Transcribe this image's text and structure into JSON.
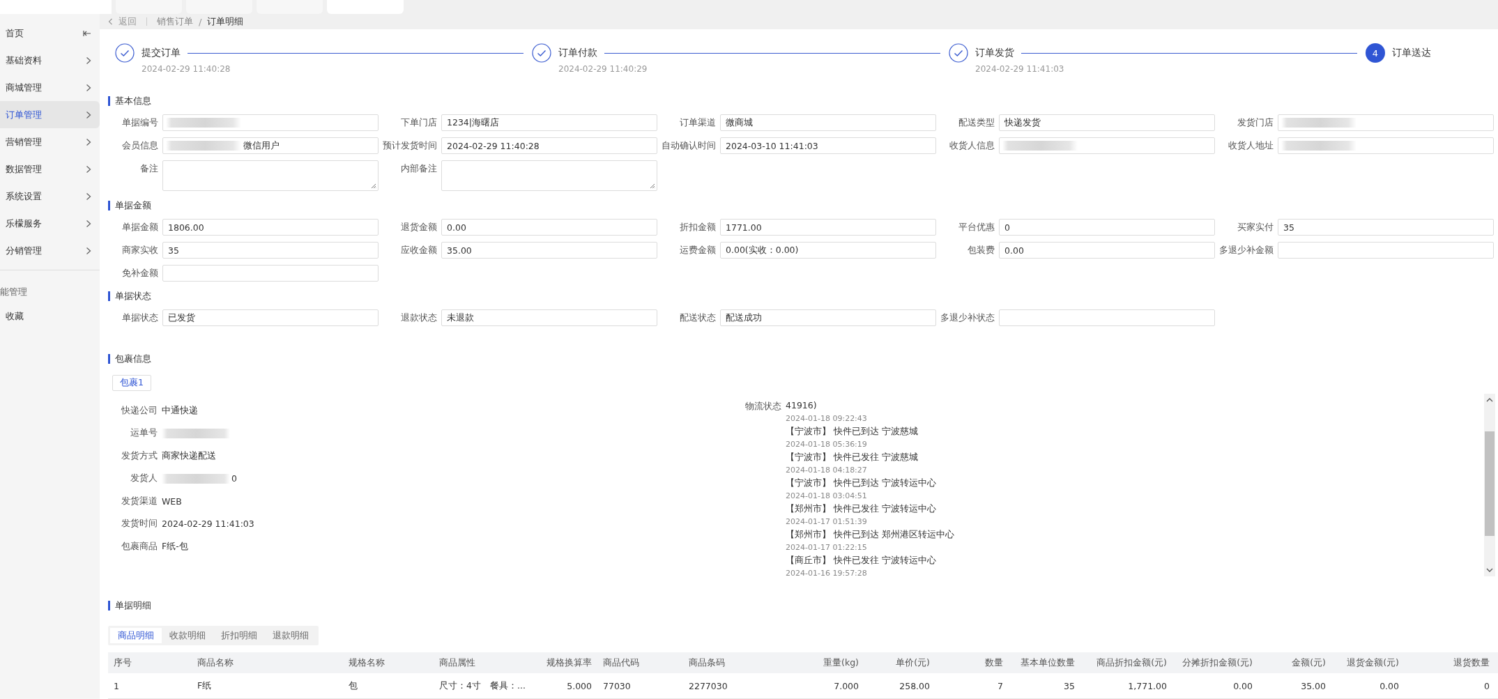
{
  "sidebar": {
    "items": [
      {
        "label": "首页",
        "kind": "collapse",
        "selected": false
      },
      {
        "label": "基础资料",
        "kind": "group",
        "selected": false
      },
      {
        "label": "商城管理",
        "kind": "group",
        "selected": false
      },
      {
        "label": "订单管理",
        "kind": "group",
        "selected": true
      },
      {
        "label": "营销管理",
        "kind": "group",
        "selected": false
      },
      {
        "label": "数据管理",
        "kind": "group",
        "selected": false
      },
      {
        "label": "系统设置",
        "kind": "group",
        "selected": false
      },
      {
        "label": "乐檬服务",
        "kind": "group",
        "selected": false
      },
      {
        "label": "分销管理",
        "kind": "group",
        "selected": false
      }
    ],
    "extra": [
      {
        "label": "能管理",
        "kind": "heading"
      },
      {
        "label": "收藏",
        "kind": "link"
      }
    ]
  },
  "breadcrumb": {
    "back": "返回",
    "items": [
      {
        "label": "销售订单",
        "current": false
      },
      {
        "label": "订单明细",
        "current": true
      }
    ],
    "separator": "/"
  },
  "steps": [
    {
      "label": "提交订单",
      "time": "2024-02-29 11:40:28",
      "completed": true
    },
    {
      "label": "订单付款",
      "time": "2024-02-29 11:40:29",
      "completed": true
    },
    {
      "label": "订单发货",
      "time": "2024-02-29 11:41:03",
      "completed": true
    },
    {
      "label": "订单送达",
      "number": "4",
      "completed": false
    }
  ],
  "sections": [
    {
      "title": "基本信息",
      "rows": [
        [
          {
            "label": "单据编号",
            "kind": "input",
            "redacted": true
          },
          {
            "label": "下单门店",
            "kind": "input",
            "value": "1234|海曙店",
            "redacted": false
          },
          {
            "label": "订单渠道",
            "kind": "input",
            "value": "微商城",
            "redacted": false
          },
          {
            "label": "配送类型",
            "kind": "input",
            "value": "快递发货",
            "redacted": false
          },
          {
            "label": "发货门店",
            "kind": "input",
            "redacted": true
          }
        ],
        [
          {
            "label": "会员信息",
            "kind": "input",
            "value": "微信用户",
            "redacted": true
          },
          {
            "label": "预计发货时间",
            "kind": "input",
            "value": "2024-02-29 11:40:28",
            "redacted": false
          },
          {
            "label": "自动确认时间",
            "kind": "input",
            "value": "2024-03-10 11:41:03",
            "redacted": false
          },
          {
            "label": "收货人信息",
            "kind": "input",
            "redacted": true
          },
          {
            "label": "收货人地址",
            "kind": "input",
            "redacted": true
          }
        ],
        [
          {
            "label": "备注",
            "kind": "textarea"
          },
          {
            "label": "内部备注",
            "kind": "textarea"
          }
        ]
      ]
    },
    {
      "title": "单据金额",
      "rows": [
        [
          {
            "label": "单据金额",
            "kind": "input",
            "value": "1806.00",
            "redacted": false
          },
          {
            "label": "退货金额",
            "kind": "input",
            "value": "0.00",
            "redacted": false
          },
          {
            "label": "折扣金额",
            "kind": "input",
            "value": "1771.00",
            "redacted": false
          },
          {
            "label": "平台优惠",
            "kind": "input",
            "value": "0",
            "redacted": false
          },
          {
            "label": "买家实付",
            "kind": "input",
            "value": "35",
            "redacted": false
          }
        ],
        [
          {
            "label": "商家实收",
            "kind": "input",
            "value": "35",
            "redacted": false
          },
          {
            "label": "应收金额",
            "kind": "input",
            "value": "35.00",
            "redacted": false
          },
          {
            "label": "运费金额",
            "kind": "input",
            "value": "0.00(实收：0.00)",
            "redacted": false
          },
          {
            "label": "包装费",
            "kind": "input",
            "value": "0.00",
            "redacted": false
          },
          {
            "label": "多退少补金额",
            "kind": "input",
            "redacted": false
          }
        ],
        [
          {
            "label": "免补金额",
            "kind": "input",
            "redacted": false
          }
        ]
      ]
    },
    {
      "title": "单据状态",
      "rows": [
        [
          {
            "label": "单据状态",
            "kind": "input",
            "value": "已发货",
            "redacted": false
          },
          {
            "label": "退款状态",
            "kind": "input",
            "value": "未退款",
            "redacted": false
          },
          {
            "label": "配送状态",
            "kind": "input",
            "value": "配送成功",
            "redacted": false
          },
          {
            "label": "多退少补状态",
            "kind": "input",
            "redacted": false
          }
        ]
      ]
    }
  ],
  "package": {
    "title": "包裹信息",
    "tabs": [
      {
        "label": "包裹1",
        "selected": true
      }
    ],
    "fields": [
      {
        "label": "快递公司",
        "value": "中通快递",
        "redacted": false
      },
      {
        "label": "运单号",
        "redacted": true
      },
      {
        "label": "发货方式",
        "value": "商家快递配送",
        "redacted": false
      },
      {
        "label": "发货人",
        "value": "0",
        "redacted": true
      },
      {
        "label": "发货渠道",
        "value": "WEB",
        "redacted": false
      },
      {
        "label": "发货时间",
        "value": "2024-02-29 11:41:03",
        "redacted": false
      },
      {
        "label": "包裹商品",
        "value": "F纸-包",
        "redacted": false
      }
    ],
    "logistics": {
      "label": "物流状态",
      "lines": [
        {
          "kind": "text",
          "text": "41916)"
        },
        {
          "kind": "time",
          "text": "2024-01-18 09:22:43"
        },
        {
          "kind": "text",
          "text": "【宁波市】 快件已到达 宁波慈城"
        },
        {
          "kind": "time",
          "text": "2024-01-18 05:36:19"
        },
        {
          "kind": "text",
          "text": "【宁波市】 快件已发往 宁波慈城"
        },
        {
          "kind": "time",
          "text": "2024-01-18 04:18:27"
        },
        {
          "kind": "text",
          "text": "【宁波市】 快件已到达 宁波转运中心"
        },
        {
          "kind": "time",
          "text": "2024-01-18 03:04:51"
        },
        {
          "kind": "text",
          "text": "【郑州市】 快件已发往 宁波转运中心"
        },
        {
          "kind": "time",
          "text": "2024-01-17 01:51:39"
        },
        {
          "kind": "text",
          "text": "【郑州市】 快件已到达 郑州港区转运中心"
        },
        {
          "kind": "time",
          "text": "2024-01-17 01:22:15"
        },
        {
          "kind": "text",
          "text": "【商丘市】 快件已发往 宁波转运中心"
        },
        {
          "kind": "time",
          "text": "2024-01-16 19:57:28"
        }
      ]
    }
  },
  "details": {
    "title": "单据明细",
    "tabs": [
      {
        "label": "商品明细",
        "selected": true
      },
      {
        "label": "收款明细",
        "selected": false
      },
      {
        "label": "折扣明细",
        "selected": false
      },
      {
        "label": "退款明细",
        "selected": false
      }
    ],
    "table": {
      "columns": [
        "序号",
        "商品名称",
        "规格名称",
        "商品属性",
        "规格换算率",
        "商品代码",
        "商品条码",
        "重量(kg)",
        "单价(元)",
        "数量",
        "基本单位数量",
        "商品折扣金额(元)",
        "分摊折扣金额(元)",
        "金额(元)",
        "退货金额(元)",
        "退货数量"
      ],
      "rows": [
        [
          "1",
          "F纸",
          "包",
          "尺寸：4寸　餐具：...",
          "5.000",
          "77030",
          "2277030",
          "7.000",
          "258.00",
          "7",
          "35",
          "1,771.00",
          "0.00",
          "35.00",
          "0.00",
          "0"
        ]
      ]
    }
  }
}
